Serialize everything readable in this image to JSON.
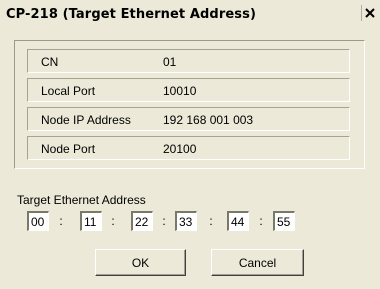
{
  "window": {
    "title": "CP-218 (Target Ethernet Address)",
    "close_icon": "close-icon"
  },
  "info": {
    "rows": [
      {
        "label": "CN",
        "value": "01"
      },
      {
        "label": "Local Port",
        "value": "10010"
      },
      {
        "label": "Node IP Address",
        "value": "192 168 001 003"
      },
      {
        "label": "Node Port",
        "value": "20100"
      }
    ]
  },
  "address": {
    "label": "Target Ethernet Address",
    "octets": [
      "00",
      "11",
      "22",
      "33",
      "44",
      "55"
    ],
    "separator": ":"
  },
  "buttons": {
    "ok_label": "OK",
    "cancel_label": "Cancel"
  },
  "colors": {
    "dialog_bg": "#ece9d8",
    "field_bg": "#ffffff"
  }
}
